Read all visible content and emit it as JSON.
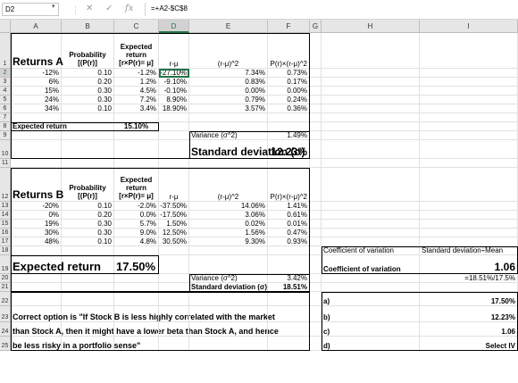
{
  "formula_bar": {
    "name_box": "D2",
    "formula": "=+A2-$C$8"
  },
  "columns": [
    "A",
    "B",
    "C",
    "D",
    "E",
    "F",
    "G",
    "H",
    "I"
  ],
  "selected_cell": "D2",
  "sheet": {
    "r1": {
      "A": "Returns A",
      "B": "Probability [(P(r)]",
      "C": "Expected return [r×P(r)= μ]",
      "D": "r-μ",
      "E": "(r-μ)^2",
      "F": "P(r)×(r-μ)^2"
    },
    "r2": {
      "A": "-12%",
      "B": "0.10",
      "C": "-1.2%",
      "D": "-27.10%",
      "E": "7.34%",
      "F": "0.73%"
    },
    "r3": {
      "A": "6%",
      "B": "0.20",
      "C": "1.2%",
      "D": "-9.10%",
      "E": "0.83%",
      "F": "0.17%"
    },
    "r4": {
      "A": "15%",
      "B": "0.30",
      "C": "4.5%",
      "D": "-0.10%",
      "E": "0.00%",
      "F": "0.00%"
    },
    "r5": {
      "A": "24%",
      "B": "0.30",
      "C": "7.2%",
      "D": "8.90%",
      "E": "0.79%",
      "F": "0.24%"
    },
    "r6": {
      "A": "34%",
      "B": "0.10",
      "C": "3.4%",
      "D": "18.90%",
      "E": "3.57%",
      "F": "0.36%"
    },
    "r8": {
      "A": "Expected return",
      "C": "15.10%"
    },
    "r9": {
      "E": "Variance (σ^2)",
      "F": "1.49%"
    },
    "r10": {
      "E": "Standard deviation (σ)",
      "F": "12.23%"
    },
    "r12": {
      "A": "Returns B",
      "B": "Probability [(P(r)]",
      "C": "Expected return [r×P(r)= μ]",
      "D": "r-μ",
      "E": "(r-μ)^2",
      "F": "P(r)×(r-μ)^2"
    },
    "r13": {
      "A": "-20%",
      "B": "0.10",
      "C": "-2.0%",
      "D": "-37.50%",
      "E": "14.06%",
      "F": "1.41%"
    },
    "r14": {
      "A": "0%",
      "B": "0.20",
      "C": "0.0%",
      "D": "-17.50%",
      "E": "3.06%",
      "F": "0.61%"
    },
    "r15": {
      "A": "19%",
      "B": "0.30",
      "C": "5.7%",
      "D": "1.50%",
      "E": "0.02%",
      "F": "0.01%"
    },
    "r16": {
      "A": "30%",
      "B": "0.30",
      "C": "9.0%",
      "D": "12.50%",
      "E": "1.56%",
      "F": "0.47%"
    },
    "r17": {
      "A": "48%",
      "B": "0.10",
      "C": "4.8%",
      "D": "30.50%",
      "E": "9.30%",
      "F": "0.93%"
    },
    "r18": {
      "H": "Coefficient of variation",
      "I": "Standard deviation÷Mean"
    },
    "r19": {
      "A": "Expected return",
      "C": "17.50%",
      "H": "Coefficient of variation",
      "I": "1.06"
    },
    "r20": {
      "E": "Variance (σ^2)",
      "F": "3.42%",
      "I": "=18.51%/17.5%"
    },
    "r21": {
      "E": "Standard deviation (σ)",
      "F": "18.51%"
    },
    "r22": {
      "H": "a)",
      "I": "17.50%"
    },
    "r23": {
      "A": "Correct option is \"If Stock B is less highly correlated with the market",
      "H": "b)",
      "I": "12.23%"
    },
    "r24": {
      "A": "than Stock A, then it might have a lower beta than Stock A, and hence",
      "H": "c)",
      "I": "1.06"
    },
    "r25": {
      "A": "be less risky in a portfolio sense\"",
      "H": "d)",
      "I": "Select IV"
    }
  },
  "accent": "#217346"
}
